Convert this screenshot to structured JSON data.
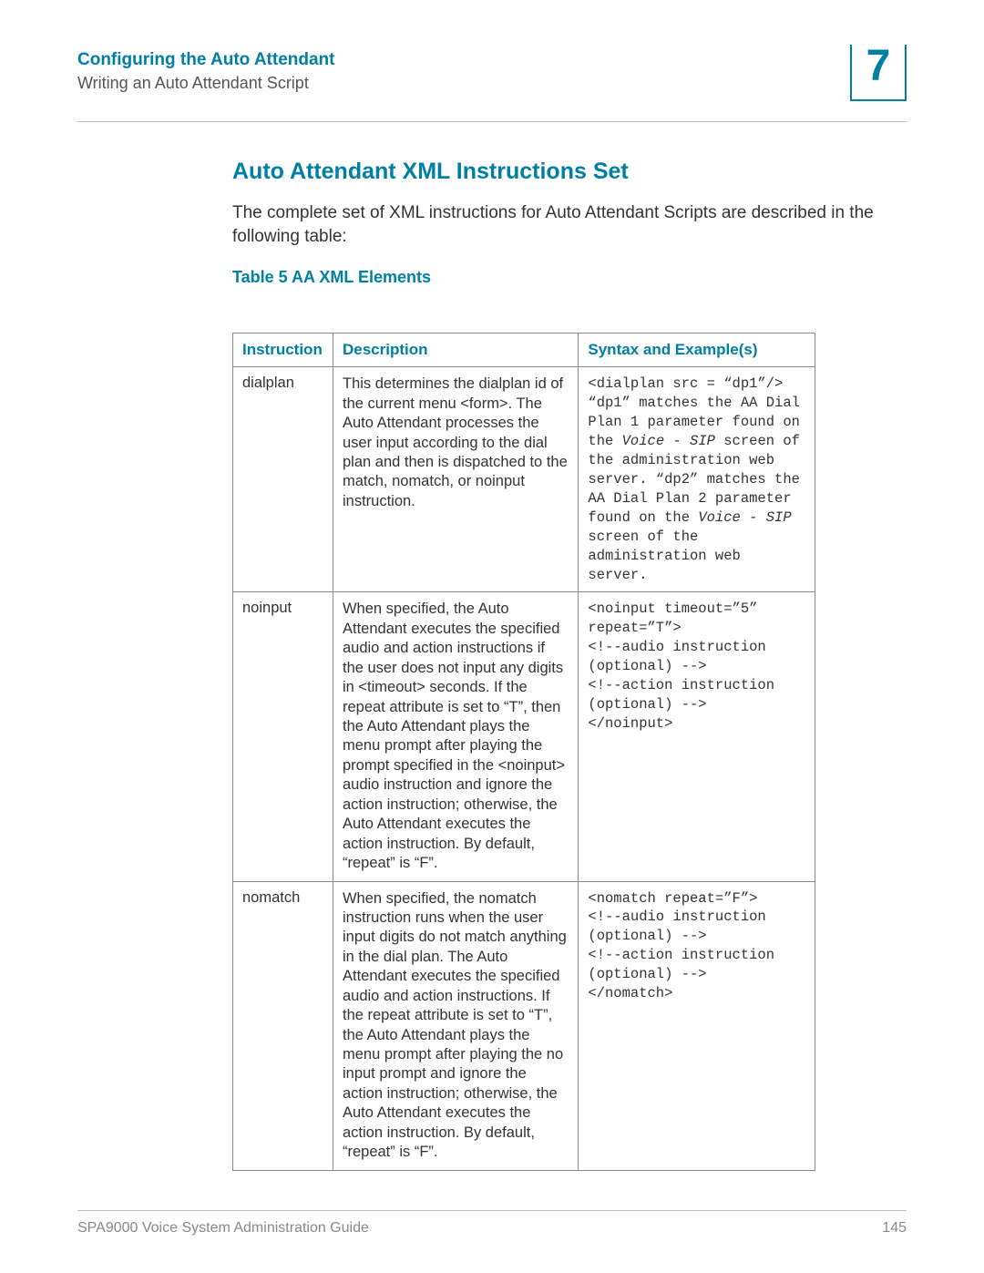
{
  "header": {
    "chapter_title": "Configuring the Auto Attendant",
    "section_title": "Writing an Auto Attendant Script",
    "chapter_number": "7"
  },
  "main": {
    "heading": "Auto Attendant XML Instructions Set",
    "intro": "The complete set of XML instructions for Auto Attendant Scripts are described in the following table:",
    "table_label": "Table 5    AA XML Elements",
    "table_headers": {
      "instruction": "Instruction",
      "description": "Description",
      "syntax": "Syntax and Example(s)"
    },
    "rows": [
      {
        "instruction": "dialplan",
        "description": "This determines the dialplan id of the current menu <form>. The Auto Attendant processes the user input according to the dial plan and then is dispatched to the match, nomatch, or noinput instruction.",
        "syntax_pre": "<dialplan src = “dp1”/>\n“dp1” matches the AA Dial Plan 1 parameter found on the ",
        "syntax_ital1": "Voice - SIP",
        "syntax_mid": " screen of the administration web server. “dp2” matches the AA Dial Plan 2 parameter found on the ",
        "syntax_ital2": "Voice - SIP",
        "syntax_post": " screen of the administration web server."
      },
      {
        "instruction": "noinput",
        "description": "When specified, the Auto Attendant executes the specified audio and action instructions if the user does not input any digits in <timeout> seconds. If the repeat attribute is set to “T”, then the Auto Attendant plays the menu prompt after playing the prompt specified in the <noinput> audio instruction and ignore the action instruction; otherwise, the Auto Attendant executes the action instruction. By default, “repeat” is “F”.",
        "syntax": "<noinput timeout=”5” repeat=”T”>\n<!--audio instruction (optional) -->\n<!--action instruction (optional) -->\n</noinput>"
      },
      {
        "instruction": "nomatch",
        "description": "When specified, the nomatch instruction runs when the user input digits do not match anything in the dial plan. The Auto Attendant executes the specified audio and action instructions. If the repeat attribute is set to “T”, the Auto Attendant plays the menu prompt after playing the no input prompt and ignore the action instruction; otherwise, the Auto Attendant executes the action instruction. By default, “repeat” is “F”.",
        "syntax": "<nomatch repeat=”F”>\n<!--audio instruction (optional) -->\n<!--action instruction (optional) -->\n</nomatch>"
      }
    ]
  },
  "footer": {
    "doc_title": "SPA9000 Voice System Administration Guide",
    "page_number": "145"
  },
  "chart_data": {
    "type": "table",
    "title": "Table 5 AA XML Elements",
    "columns": [
      "Instruction",
      "Description",
      "Syntax and Example(s)"
    ],
    "rows": [
      [
        "dialplan",
        "This determines the dialplan id of the current menu <form>. The Auto Attendant processes the user input according to the dial plan and then is dispatched to the match, nomatch, or noinput instruction.",
        "<dialplan src = \"dp1\"/> \"dp1\" matches the AA Dial Plan 1 parameter found on the Voice - SIP screen of the administration web server. \"dp2\" matches the AA Dial Plan 2 parameter found on the Voice - SIP screen of the administration web server."
      ],
      [
        "noinput",
        "When specified, the Auto Attendant executes the specified audio and action instructions if the user does not input any digits in <timeout> seconds. If the repeat attribute is set to \"T\", then the Auto Attendant plays the menu prompt after playing the prompt specified in the <noinput> audio instruction and ignore the action instruction; otherwise, the Auto Attendant executes the action instruction. By default, \"repeat\" is \"F\".",
        "<noinput timeout=\"5\" repeat=\"T\"> <!--audio instruction (optional) --> <!--action instruction (optional) --> </noinput>"
      ],
      [
        "nomatch",
        "When specified, the nomatch instruction runs when the user input digits do not match anything in the dial plan. The Auto Attendant executes the specified audio and action instructions. If the repeat attribute is set to \"T\", the Auto Attendant plays the menu prompt after playing the no input prompt and ignore the action instruction; otherwise, the Auto Attendant executes the action instruction. By default, \"repeat\" is \"F\".",
        "<nomatch repeat=\"F\"> <!--audio instruction (optional) --> <!--action instruction (optional) --> </nomatch>"
      ]
    ]
  }
}
